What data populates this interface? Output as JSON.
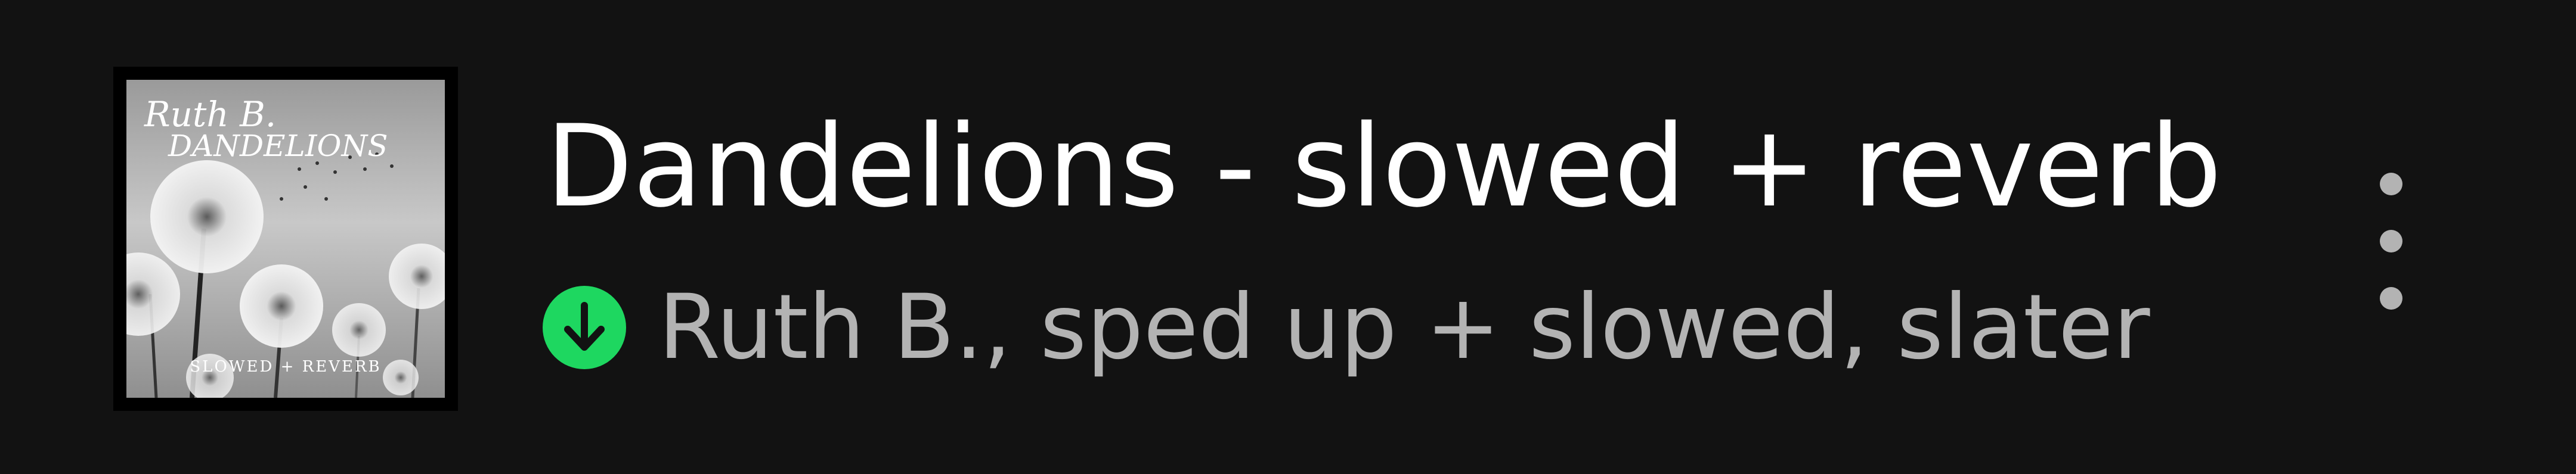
{
  "track": {
    "title": "Dandelions - slowed + reverb",
    "artists": "Ruth B., sped up + slowed, slater",
    "downloaded": true
  },
  "cover_art": {
    "line1": "Ruth B.",
    "line2": "DANDELIONS",
    "footer": "SLOWED + REVERB"
  },
  "icons": {
    "download": "arrow-down-icon",
    "more": "more-vertical-icon"
  },
  "colors": {
    "background": "#121212",
    "title": "#ffffff",
    "subtitle": "#b3b3b3",
    "download_badge": "#1ed760"
  }
}
